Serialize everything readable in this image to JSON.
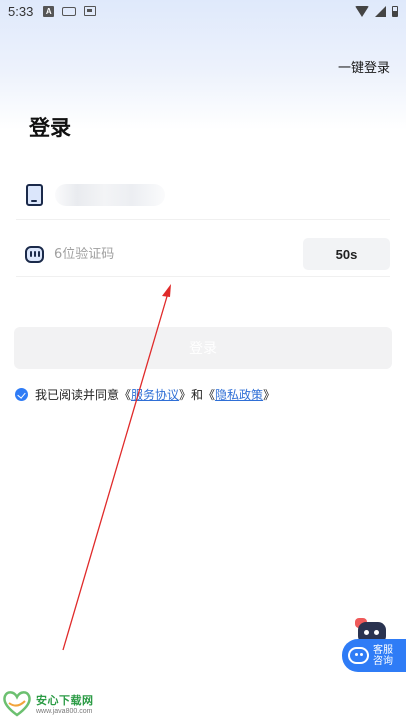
{
  "status_bar": {
    "time": "5:33",
    "icons": [
      "a-icon",
      "keyboard-icon",
      "card-icon",
      "wifi-icon",
      "signal-icon",
      "battery-icon"
    ]
  },
  "header": {
    "one_key_login": "一键登录"
  },
  "title": "登录",
  "phone_field": {
    "icon": "phone-icon"
  },
  "code_field": {
    "icon": "message-icon",
    "placeholder": "6位验证码",
    "countdown": "50s"
  },
  "login_button": {
    "label": "登录"
  },
  "agreement": {
    "prefix": "我已阅读并同意《",
    "link1": "服务协议",
    "middle": "》和《",
    "link2": "隐私政策",
    "suffix": "》"
  },
  "customer_service": {
    "label": "客服咨询"
  },
  "watermark": {
    "title": "安心下载网",
    "url": "www.java800.com"
  },
  "colors": {
    "accent": "#2f7cf6",
    "link": "#2f6fd6",
    "annotation_arrow": "#e02a2a",
    "watermark_green": "#2b9b45"
  }
}
